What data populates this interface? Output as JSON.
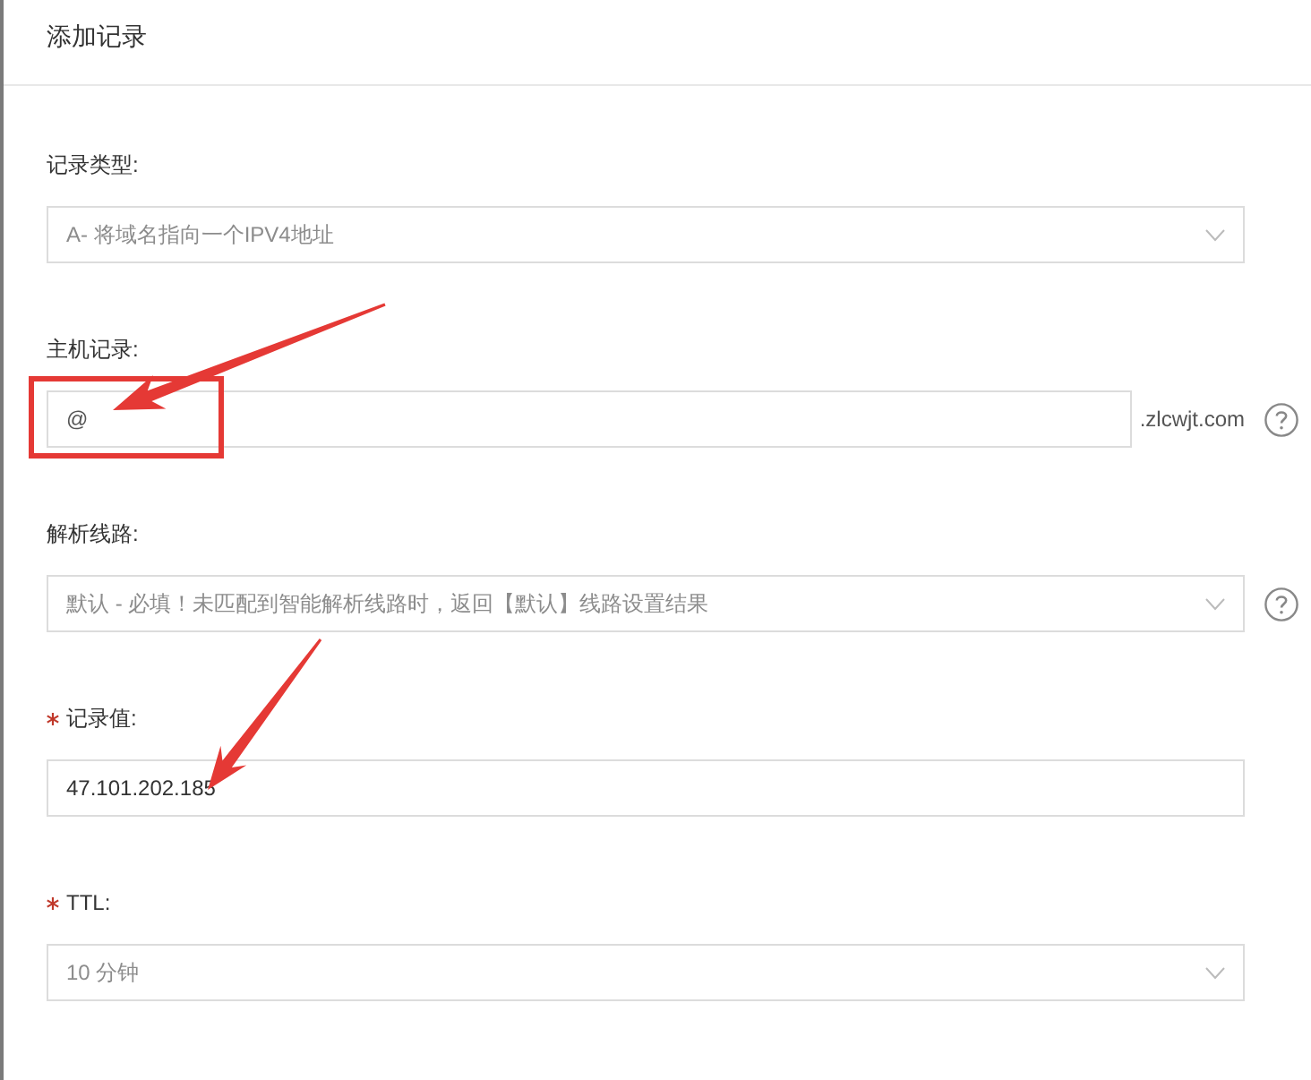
{
  "dialog": {
    "title": "添加记录"
  },
  "fields": [
    {
      "kind": "select",
      "label": "记录类型:",
      "required": false,
      "value": "A- 将域名指向一个IPV4地址",
      "help": false
    },
    {
      "kind": "input",
      "label": "主机记录:",
      "required": false,
      "value": "@",
      "suffix": ".zlcwjt.com",
      "help": true
    },
    {
      "kind": "select",
      "label": "解析线路:",
      "required": false,
      "value": "默认 - 必填！未匹配到智能解析线路时，返回【默认】线路设置结果",
      "help": true
    },
    {
      "kind": "input",
      "label": "记录值:",
      "required": true,
      "value": "47.101.202.185",
      "help": false
    },
    {
      "kind": "select",
      "label": "TTL:",
      "required": true,
      "value": "10 分钟",
      "help": false
    }
  ]
}
